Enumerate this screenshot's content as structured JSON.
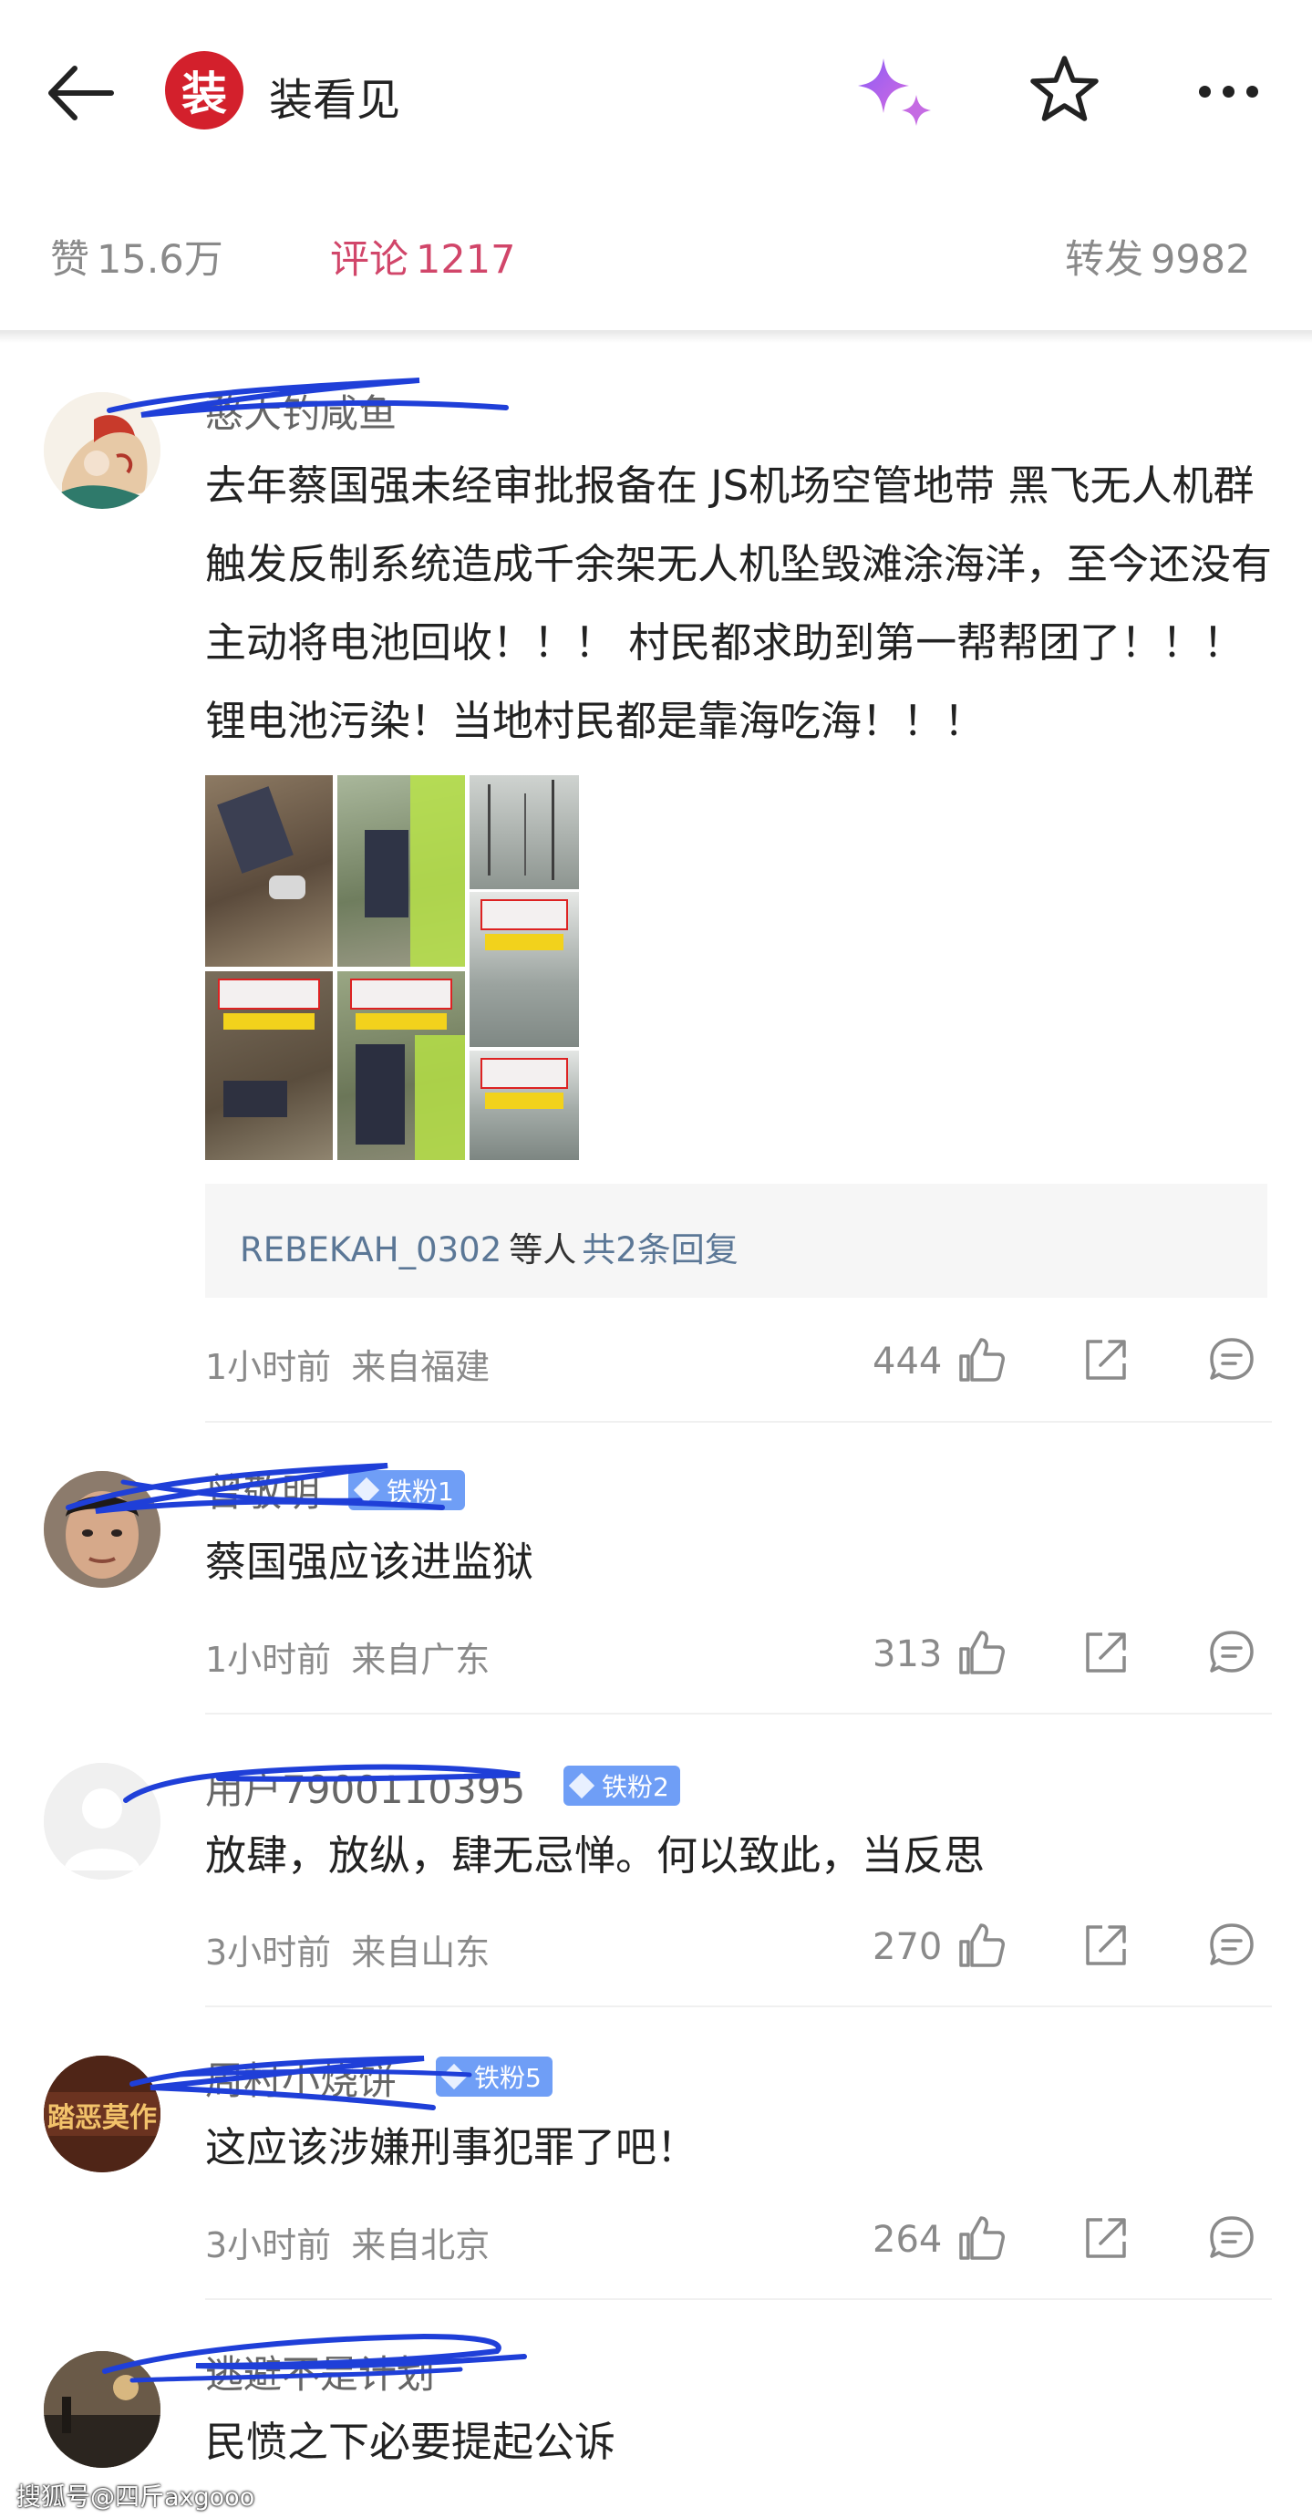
{
  "header": {
    "account_name": "装看见",
    "logo_char": "装"
  },
  "stats": {
    "likes_label": "赞",
    "likes_value": "15.6万",
    "comments_label": "评论",
    "comments_value": "1217",
    "reposts_label": "转发",
    "reposts_value": "9982"
  },
  "comments": [
    {
      "name": "憨大钓咸鱼",
      "text": "去年蔡国强未经审批报备在 JS机场空管地带 黑飞无人机群触发反制系统造成千余架无人机坠毁滩涂海洋，至今还没有主动将电池回收！！！ 村民都求助到第一帮帮团了！！！ 锂电池污染！当地村民都是靠海吃海！！！",
      "time": "1小时前",
      "location": "来自福建",
      "likes": "444",
      "reply_box": {
        "user": "REBEKAH_0302",
        "etc": "等人",
        "count": "共2条回复"
      },
      "image_captions": [
        "村委：已经扔掉几百架",
        "村委：已经扔掉几百架",
        "村委：已经扔掉几百架",
        "村委：已经扔掉几百架"
      ]
    },
    {
      "name": "曾敬明",
      "badge": "铁粉1",
      "text": "蔡国强应该进监狱",
      "time": "1小时前",
      "location": "来自广东",
      "likes": "313"
    },
    {
      "name": "用户7900110395",
      "badge": "铁粉2",
      "text": "放肆，放纵，肆无忌惮。何以致此，当反思",
      "time": "3小时前",
      "location": "来自山东",
      "likes": "270"
    },
    {
      "name": "周村小烧饼",
      "badge": "铁粉5",
      "avatar_text": "踏恶莫作",
      "text": "这应该涉嫌刑事犯罪了吧！",
      "time": "3小时前",
      "location": "来自北京",
      "likes": "264"
    },
    {
      "name": "逃避不是计划",
      "text": "民愤之下必要提起公诉"
    }
  ],
  "watermark": "搜狐号@四斤axgooo",
  "colors": {
    "accent_pink": "#d1466a",
    "badge_blue": "#6f9ef6",
    "link_blue": "#5b7796",
    "logo_red": "#d3202c",
    "scribble_blue": "#1f3fd8"
  },
  "icons": [
    "back-arrow-icon",
    "sparkle-icon",
    "star-icon",
    "more-icon",
    "thumbs-up-icon",
    "share-icon",
    "comment-icon"
  ]
}
